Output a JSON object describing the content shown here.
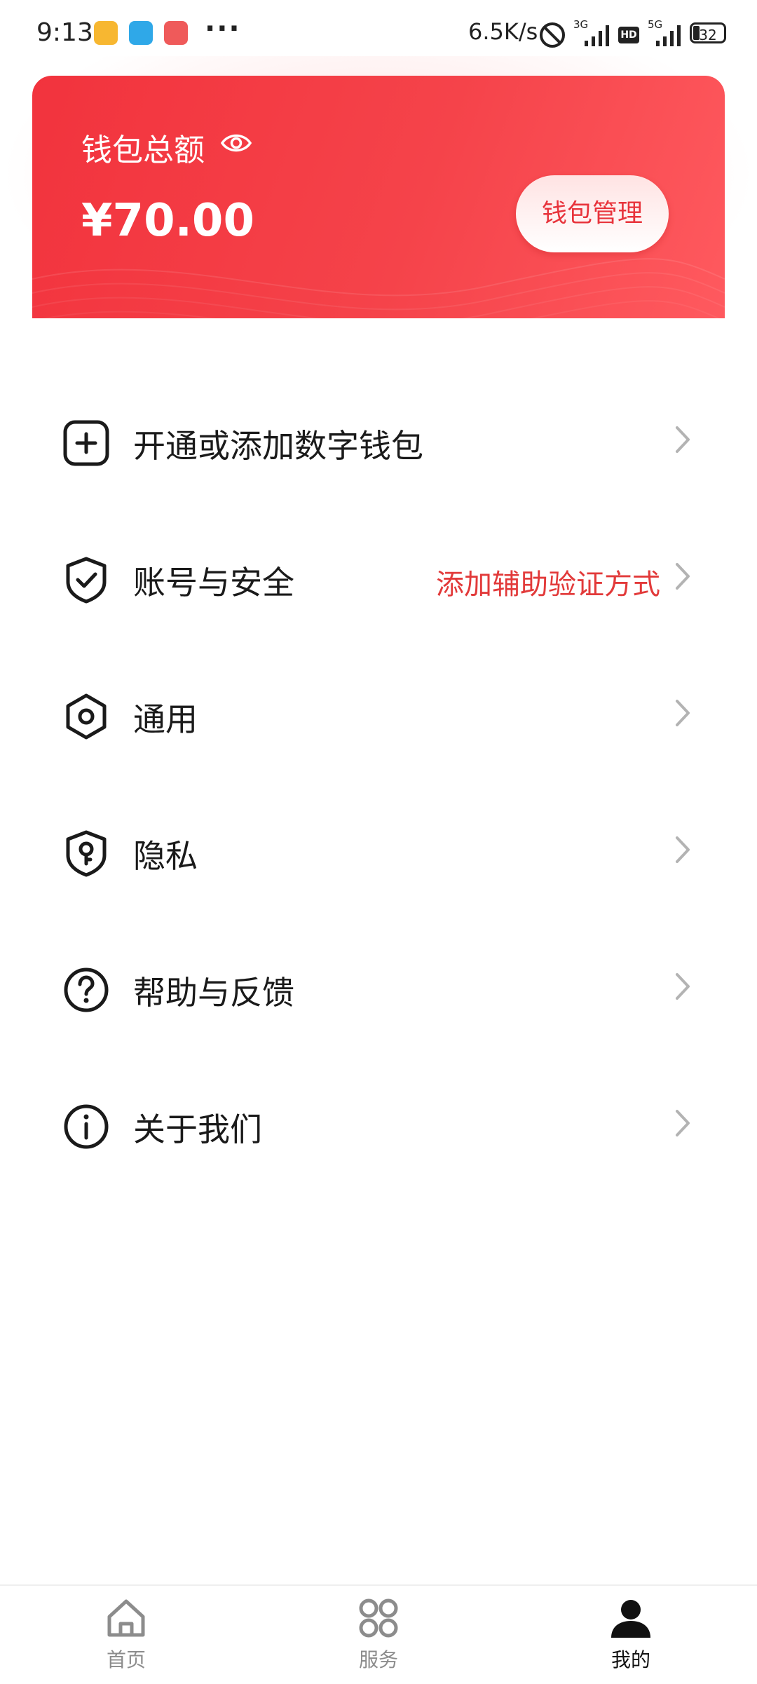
{
  "status_bar": {
    "time": "9:13",
    "net_speed": "6.5K/s",
    "net1": "3G",
    "net2": "5G",
    "hd": "HD",
    "battery": "32"
  },
  "wallet": {
    "title": "钱包总额",
    "amount": "¥70.00",
    "manage_label": "钱包管理"
  },
  "menu": {
    "items": [
      {
        "label": "开通或添加数字钱包",
        "hint": "",
        "icon": "plus-square-icon"
      },
      {
        "label": "账号与安全",
        "hint": "添加辅助验证方式",
        "icon": "shield-check-icon"
      },
      {
        "label": "通用",
        "hint": "",
        "icon": "hex-gear-icon"
      },
      {
        "label": "隐私",
        "hint": "",
        "icon": "privacy-shield-icon"
      },
      {
        "label": "帮助与反馈",
        "hint": "",
        "icon": "help-circle-icon"
      },
      {
        "label": "关于我们",
        "hint": "",
        "icon": "info-circle-icon"
      }
    ]
  },
  "bottom_nav": {
    "items": [
      {
        "label": "首页",
        "icon": "home-icon",
        "active": false
      },
      {
        "label": "服务",
        "icon": "grid-icon",
        "active": false
      },
      {
        "label": "我的",
        "icon": "person-icon",
        "active": true
      }
    ]
  },
  "colors": {
    "card_red": "#f2333d",
    "accent_red": "#e23a3a",
    "text_dark": "#1a1a1a",
    "nav_inactive": "#8c8c8c"
  }
}
